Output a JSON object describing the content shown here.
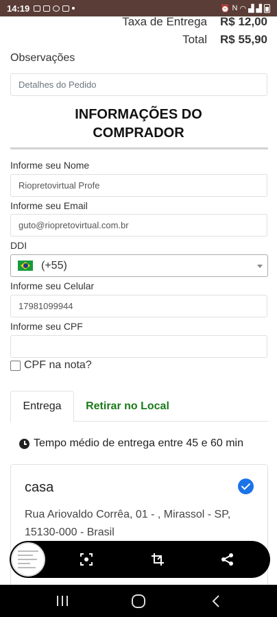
{
  "status_bar": {
    "time": "14:19",
    "battery_icon": "battery-icon"
  },
  "totals": {
    "delivery_fee_label": "Taxa de Entrega",
    "delivery_fee_value": "R$ 12,00",
    "total_label": "Total",
    "total_value": "R$ 55,90"
  },
  "observations": {
    "label": "Observações",
    "placeholder": "Detalhes do Pedido"
  },
  "buyer_section": {
    "title_line1": "INFORMAÇÕES DO",
    "title_line2": "COMPRADOR"
  },
  "fields": {
    "name": {
      "label": "Informe seu Nome",
      "value": "Riopretovirtual Profe"
    },
    "email": {
      "label": "Informe seu Email",
      "value": "guto@riopretovirtual.com.br"
    },
    "ddi": {
      "label": "DDI",
      "value": "(+55)"
    },
    "phone": {
      "label": "Informe seu Celular",
      "value": "17981099944"
    },
    "cpf": {
      "label": "Informe seu CPF",
      "value": ""
    }
  },
  "cpf_note": {
    "label": "CPF na nota?",
    "checked": false
  },
  "tabs": [
    {
      "label": "Entrega",
      "active": true
    },
    {
      "label": "Retirar no Local",
      "active": false
    }
  ],
  "delivery_time": {
    "text": "Tempo médio de entrega entre 45 e 60 min"
  },
  "address": {
    "title": "casa",
    "line1": "Rua Ariovaldo Corrêa, 01 - , Mirassol - SP,",
    "line2": "15130-000 - Brasil",
    "selected": true
  },
  "colors": {
    "accent_green": "#1a7a1a",
    "check_blue": "#1a73e8",
    "status_bar": "#5a3d36"
  }
}
